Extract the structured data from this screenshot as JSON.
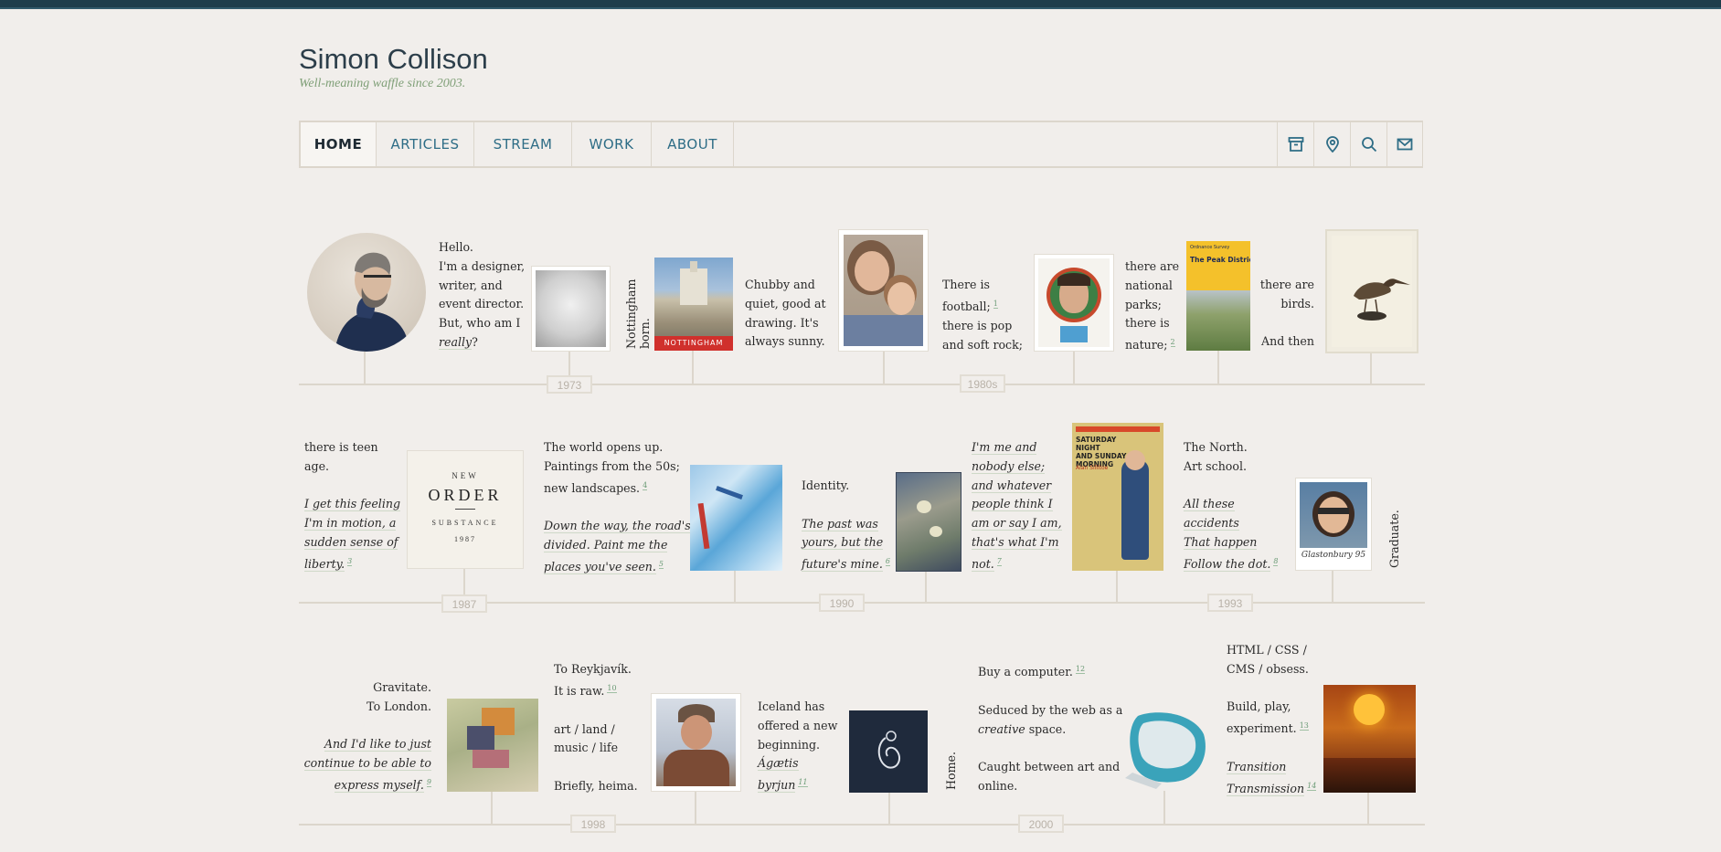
{
  "header": {
    "title": "Simon Collison",
    "tagline": "Well-meaning waffle since 2003."
  },
  "nav": {
    "items": [
      {
        "label": "HOME",
        "active": true
      },
      {
        "label": "ARTICLES"
      },
      {
        "label": "STREAM"
      },
      {
        "label": "WORK"
      },
      {
        "label": "ABOUT"
      }
    ],
    "icons": [
      "archive-icon",
      "location-pin-icon",
      "search-icon",
      "mail-icon"
    ]
  },
  "colors": {
    "background": "#f1eeeb",
    "topbar": "#1e3d4b",
    "link": "#2e6d86",
    "tagline": "#7f9f77",
    "rule": "#dcd6cc"
  },
  "row1": {
    "intro": [
      "Hello.",
      "I'm a designer,",
      "writer, and",
      "event director.",
      "But, who am I",
      "really",
      "?"
    ],
    "born": "Nottingham born.",
    "nottingham_label": "NOTTINGHAM",
    "chubby": [
      "Chubby and",
      "quiet, good at",
      "drawing. It's",
      "always sunny."
    ],
    "football": [
      "There is",
      "football;",
      "there is pop",
      "and soft rock;"
    ],
    "parks": [
      "there are",
      "national",
      "parks;",
      "there is",
      "nature;"
    ],
    "map_brand": "Ordnance Survey",
    "map_title": "The Peak District",
    "birds": [
      "there are",
      "birds.",
      "And then"
    ],
    "fn1": "1",
    "fn2": "2",
    "year1": "1973",
    "year2": "1980s"
  },
  "row2": {
    "teen": [
      "there is teen",
      "age."
    ],
    "teen_quote": [
      "I get this feeling",
      "I'm in motion, a",
      "sudden sense of",
      "liberty."
    ],
    "fn3": "3",
    "album": {
      "new": "NEW",
      "order": "ORDER",
      "substance": "SUBSTANCE",
      "year": "1987"
    },
    "world": [
      "The world opens up.",
      "Paintings from the 50s;",
      "new landscapes."
    ],
    "fn4": "4",
    "world_quote": [
      "Down the way, the road's",
      "divided. Paint me the",
      "places you've seen."
    ],
    "fn5": "5",
    "identity": "Identity.",
    "identity_quote": [
      "The past was",
      "yours, but the",
      "future's mine."
    ],
    "fn6": "6",
    "me_quote": [
      "I'm me and",
      "nobody else;",
      "and whatever",
      "people think I",
      "am or say I am,",
      "that's what I'm",
      "not."
    ],
    "fn7": "7",
    "book": {
      "title1": "SATURDAY NIGHT",
      "title2": "AND SUNDAY",
      "title3": "MORNING",
      "author": "Alan Sillitoe"
    },
    "north": [
      "The North.",
      "Art school."
    ],
    "north_quote": [
      "All these",
      "accidents",
      "That happen",
      "Follow the dot."
    ],
    "fn8": "8",
    "glasto": "Glastonbury 95",
    "graduate": "Graduate.",
    "year1": "1987",
    "year2": "1990",
    "year3": "1993"
  },
  "row3": {
    "gravitate": [
      "Gravitate.",
      "To London."
    ],
    "gravitate_quote": [
      "And I'd like to just",
      "continue to be able to",
      "express myself."
    ],
    "fn9": "9",
    "reykjavik": [
      "To Reykjavík.",
      "It is raw."
    ],
    "fn10": "10",
    "art": [
      "art / land /",
      "music / life"
    ],
    "heima": "Briefly, heima.",
    "iceland": [
      "Iceland has",
      "offered a new",
      "beginning."
    ],
    "iceland_quote": [
      "Ágætis",
      "byrjun"
    ],
    "fn11": "11",
    "home": "Home.",
    "computer": "Buy a computer.",
    "fn12": "12",
    "seduced": [
      "Seduced by the web as a",
      "creative",
      " space."
    ],
    "caught": [
      "Caught between art and",
      "online."
    ],
    "html": [
      "HTML / CSS /",
      "CMS / obsess."
    ],
    "build": [
      "Build, play,",
      "experiment."
    ],
    "fn13": "13",
    "transition": [
      "Transition",
      "Transmission"
    ],
    "fn14": "14",
    "year1": "1998",
    "year2": "2000"
  }
}
